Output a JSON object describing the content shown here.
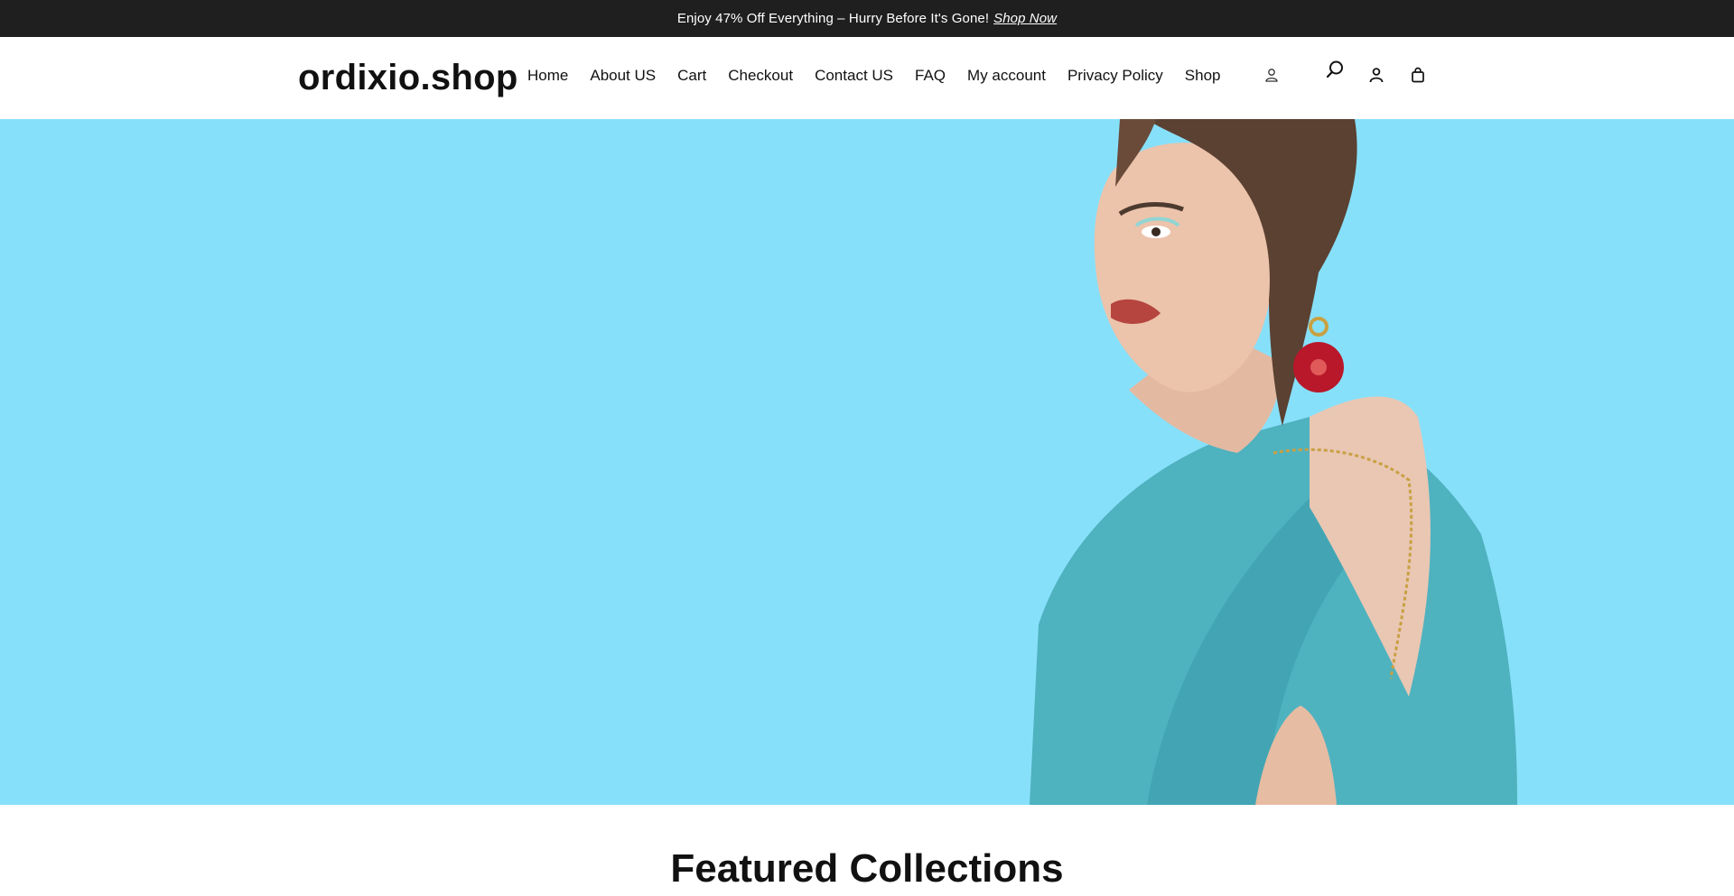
{
  "announcement": {
    "text": "Enjoy 47% Off Everything – Hurry Before It's Gone!",
    "link": "Shop Now"
  },
  "brand": {
    "logo": "ordixio.shop"
  },
  "nav": [
    "Home",
    "About US",
    "Cart",
    "Checkout",
    "Contact US",
    "FAQ",
    "My account",
    "Privacy Policy",
    "Shop"
  ],
  "header_icons": [
    "user-outline-icon",
    "search-icon",
    "account-icon",
    "cart-bag-icon"
  ],
  "hero": {
    "background": "#87e0fa",
    "image": "woman-in-teal-blazer-with-red-earring",
    "slides": 3,
    "active_slide": 1
  },
  "featured": {
    "title": "Featured Collections"
  },
  "colors": {
    "announcement_bg": "#1f1f1f",
    "hero_bg": "#87e0fa",
    "dot_active": "#2a9cc4"
  }
}
